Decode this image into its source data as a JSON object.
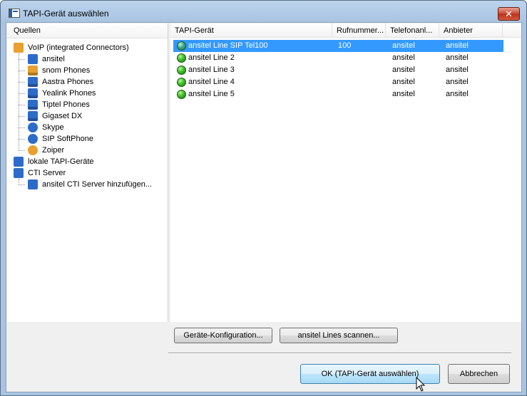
{
  "window": {
    "title": "TAPI-Gerät auswählen",
    "close_glyph": "✕"
  },
  "left": {
    "header": "Quellen",
    "tree": [
      {
        "label": "VoIP (integrated Connectors)",
        "icon": "folder-icon",
        "color": "#e8a030"
      },
      {
        "label": "ansitel",
        "icon": "snowflake-icon",
        "color": "#2d6bc9"
      },
      {
        "label": "snom Phones",
        "icon": "phone-icon",
        "color": "#e8a030"
      },
      {
        "label": "Aastra Phones",
        "icon": "phone-icon",
        "color": "#2d6bc9"
      },
      {
        "label": "Yealink Phones",
        "icon": "phone-icon",
        "color": "#2d6bc9"
      },
      {
        "label": "Tiptel Phones",
        "icon": "phone-icon",
        "color": "#2d6bc9"
      },
      {
        "label": "Gigaset DX",
        "icon": "phone-icon",
        "color": "#2d6bc9"
      },
      {
        "label": "Skype",
        "icon": "skype-icon",
        "color": "#2d6bc9"
      },
      {
        "label": "SIP SoftPhone",
        "icon": "headset-icon",
        "color": "#2d6bc9"
      },
      {
        "label": "Zoiper",
        "icon": "zoiper-icon",
        "color": "#e8a030"
      },
      {
        "label": "lokale TAPI-Geräte",
        "icon": "tapi-icon",
        "color": "#2d6bc9"
      },
      {
        "label": "CTI Server",
        "icon": "server-icon",
        "color": "#2d6bc9"
      },
      {
        "label": "ansitel CTI Server hinzufügen...",
        "icon": "server-add-icon",
        "color": "#2d6bc9"
      }
    ]
  },
  "table": {
    "columns": [
      "TAPI-Gerät",
      "Rufnummer...",
      "Telefonanl...",
      "Anbieter"
    ],
    "rows": [
      [
        "ansitel Line  SIP Tel100",
        "100",
        "ansitel",
        "ansitel"
      ],
      [
        "ansitel Line 2",
        "",
        "ansitel",
        "ansitel"
      ],
      [
        "ansitel Line 3",
        "",
        "ansitel",
        "ansitel"
      ],
      [
        "ansitel Line 4",
        "",
        "ansitel",
        "ansitel"
      ],
      [
        "ansitel Line 5",
        "",
        "ansitel",
        "ansitel"
      ]
    ],
    "selected_row": 0
  },
  "buttons": {
    "config": "Geräte-Konfiguration...",
    "scan": "ansitel Lines scannen...",
    "ok": "OK   (TAPI-Gerät auswählen)",
    "cancel": "Abbrechen"
  }
}
